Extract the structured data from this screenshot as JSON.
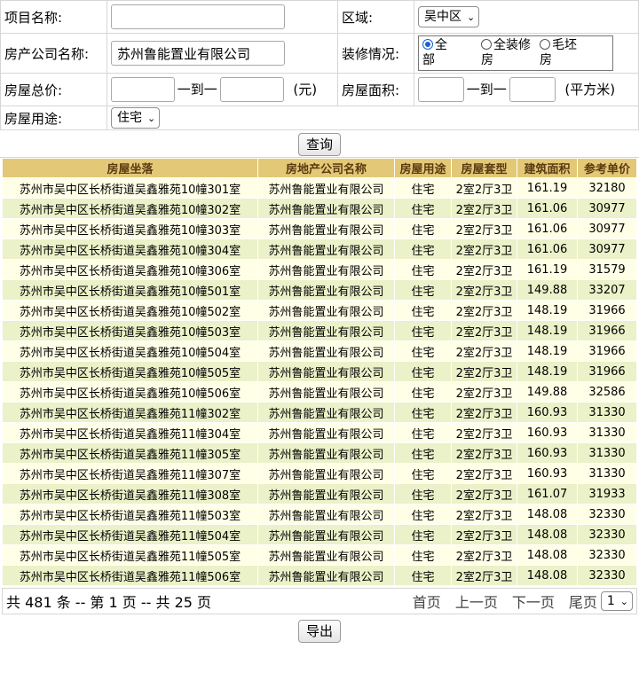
{
  "form": {
    "project_name_label": "项目名称:",
    "project_name_value": "",
    "district_label": "区域:",
    "district_value": "吴中区",
    "company_label": "房产公司名称:",
    "company_value": "苏州鲁能置业有限公司",
    "decoration_label": "装修情况:",
    "decoration_options": [
      {
        "label": "全部",
        "line1": "全",
        "line2": "部",
        "selected": true
      },
      {
        "label": "全装修房",
        "line1": "全装修",
        "line2": "房",
        "selected": false
      },
      {
        "label": "毛坯房",
        "line1": "毛坯",
        "line2": "房",
        "selected": false
      }
    ],
    "total_price_label": "房屋总价:",
    "price_from": "",
    "to_text": "一到一",
    "price_to": "",
    "price_unit": "(元)",
    "area_label": "房屋面积:",
    "area_from": "",
    "area_to": "",
    "area_unit": "(平方米)",
    "usage_label": "房屋用途:",
    "usage_value": "住宅",
    "query_button": "查询"
  },
  "table": {
    "headers": [
      "房屋坐落",
      "房地产公司名称",
      "房屋用途",
      "房屋套型",
      "建筑面积",
      "参考单价"
    ],
    "rows": [
      [
        "苏州市吴中区长桥街道吴鑫雅苑10幢301室",
        "苏州鲁能置业有限公司",
        "住宅",
        "2室2厅3卫",
        "161.19",
        "32180"
      ],
      [
        "苏州市吴中区长桥街道吴鑫雅苑10幢302室",
        "苏州鲁能置业有限公司",
        "住宅",
        "2室2厅3卫",
        "161.06",
        "30977"
      ],
      [
        "苏州市吴中区长桥街道吴鑫雅苑10幢303室",
        "苏州鲁能置业有限公司",
        "住宅",
        "2室2厅3卫",
        "161.06",
        "30977"
      ],
      [
        "苏州市吴中区长桥街道吴鑫雅苑10幢304室",
        "苏州鲁能置业有限公司",
        "住宅",
        "2室2厅3卫",
        "161.06",
        "30977"
      ],
      [
        "苏州市吴中区长桥街道吴鑫雅苑10幢306室",
        "苏州鲁能置业有限公司",
        "住宅",
        "2室2厅3卫",
        "161.19",
        "31579"
      ],
      [
        "苏州市吴中区长桥街道吴鑫雅苑10幢501室",
        "苏州鲁能置业有限公司",
        "住宅",
        "2室2厅3卫",
        "149.88",
        "33207"
      ],
      [
        "苏州市吴中区长桥街道吴鑫雅苑10幢502室",
        "苏州鲁能置业有限公司",
        "住宅",
        "2室2厅3卫",
        "148.19",
        "31966"
      ],
      [
        "苏州市吴中区长桥街道吴鑫雅苑10幢503室",
        "苏州鲁能置业有限公司",
        "住宅",
        "2室2厅3卫",
        "148.19",
        "31966"
      ],
      [
        "苏州市吴中区长桥街道吴鑫雅苑10幢504室",
        "苏州鲁能置业有限公司",
        "住宅",
        "2室2厅3卫",
        "148.19",
        "31966"
      ],
      [
        "苏州市吴中区长桥街道吴鑫雅苑10幢505室",
        "苏州鲁能置业有限公司",
        "住宅",
        "2室2厅3卫",
        "148.19",
        "31966"
      ],
      [
        "苏州市吴中区长桥街道吴鑫雅苑10幢506室",
        "苏州鲁能置业有限公司",
        "住宅",
        "2室2厅3卫",
        "149.88",
        "32586"
      ],
      [
        "苏州市吴中区长桥街道吴鑫雅苑11幢302室",
        "苏州鲁能置业有限公司",
        "住宅",
        "2室2厅3卫",
        "160.93",
        "31330"
      ],
      [
        "苏州市吴中区长桥街道吴鑫雅苑11幢304室",
        "苏州鲁能置业有限公司",
        "住宅",
        "2室2厅3卫",
        "160.93",
        "31330"
      ],
      [
        "苏州市吴中区长桥街道吴鑫雅苑11幢305室",
        "苏州鲁能置业有限公司",
        "住宅",
        "2室2厅3卫",
        "160.93",
        "31330"
      ],
      [
        "苏州市吴中区长桥街道吴鑫雅苑11幢307室",
        "苏州鲁能置业有限公司",
        "住宅",
        "2室2厅3卫",
        "160.93",
        "31330"
      ],
      [
        "苏州市吴中区长桥街道吴鑫雅苑11幢308室",
        "苏州鲁能置业有限公司",
        "住宅",
        "2室2厅3卫",
        "161.07",
        "31933"
      ],
      [
        "苏州市吴中区长桥街道吴鑫雅苑11幢503室",
        "苏州鲁能置业有限公司",
        "住宅",
        "2室2厅3卫",
        "148.08",
        "32330"
      ],
      [
        "苏州市吴中区长桥街道吴鑫雅苑11幢504室",
        "苏州鲁能置业有限公司",
        "住宅",
        "2室2厅3卫",
        "148.08",
        "32330"
      ],
      [
        "苏州市吴中区长桥街道吴鑫雅苑11幢505室",
        "苏州鲁能置业有限公司",
        "住宅",
        "2室2厅3卫",
        "148.08",
        "32330"
      ],
      [
        "苏州市吴中区长桥街道吴鑫雅苑11幢506室",
        "苏州鲁能置业有限公司",
        "住宅",
        "2室2厅3卫",
        "148.08",
        "32330"
      ]
    ]
  },
  "pager": {
    "info": "共 481 条 -- 第 1 页 -- 共 25 页",
    "first": "首页",
    "prev": "上一页",
    "next": "下一页",
    "last": "尾页",
    "page_select": "1"
  },
  "export_button": "导出",
  "colors": {
    "header_bg": "#e3c977",
    "row_odd": "#ffffe7",
    "row_even": "#ebf1c8",
    "radio_accent": "#1a5fd6"
  }
}
